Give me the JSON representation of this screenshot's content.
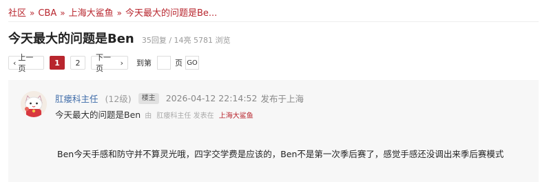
{
  "breadcrumb": {
    "items": [
      "社区",
      "CBA",
      "上海大鲨鱼",
      "今天最大的问题是Be..."
    ],
    "separator": "»"
  },
  "thread": {
    "title": "今天最大的问题是Ben",
    "stats": "35回复 / 14亮 5781 浏览"
  },
  "pager": {
    "prev_label": "上一页",
    "pages": [
      "1",
      "2"
    ],
    "active_page": "1",
    "next_label": "下一页",
    "goto_label": "到第",
    "goto_value": "",
    "page_label": "页",
    "go_label": "GO"
  },
  "post": {
    "username": "肛瘘科主任",
    "level": "(12级)",
    "badge": "楼主",
    "time": "2026-04-12 22:14:52",
    "location": "发布于上海",
    "sub_title": "今天最大的问题是Ben",
    "sub_by": "由",
    "sub_author": "肛瘘科主任",
    "sub_posted_in": "发表在",
    "sub_board": "上海大鲨鱼",
    "content": "Ben今天手感和防守并不算灵光哦，四字交学费是应该的，Ben不是第一次季后赛了，感觉手感还没调出来季后赛模式"
  },
  "colors": {
    "accent": "#b8262e",
    "link": "#3e6ba8",
    "post_bg": "#f7f7f7"
  },
  "icons": {
    "avatar": "lucky-cat-avatar",
    "prev": "chevron-left-icon",
    "next": "chevron-right-icon"
  }
}
